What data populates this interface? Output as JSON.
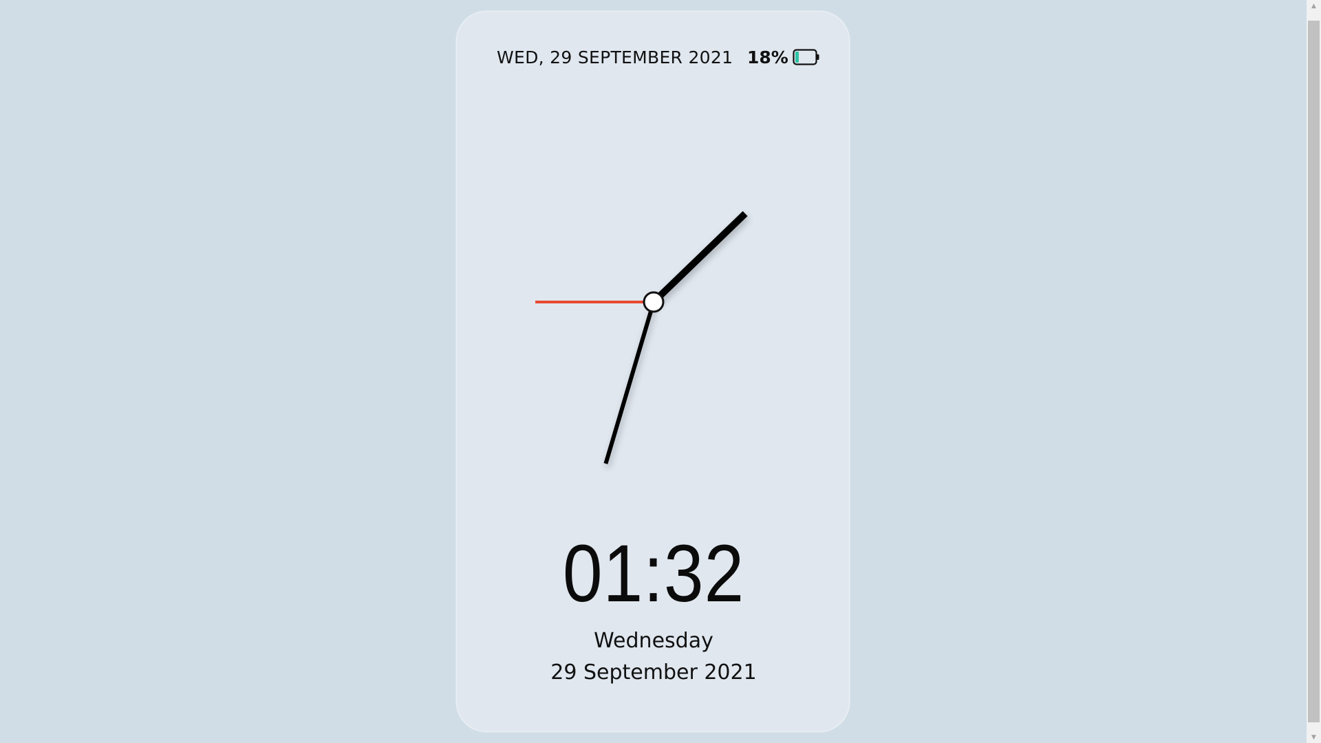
{
  "status_bar": {
    "date": "WED, 29 SEPTEMBER 2021",
    "battery_percent_label": "18%",
    "battery_level": 0.18,
    "battery_accent_color": "#2ec4a6",
    "battery_icon": "battery-icon"
  },
  "clock": {
    "hour": 1,
    "minute": 32,
    "second": 45,
    "hand_color": "#000000",
    "second_hand_color": "#e8492f",
    "center_cap_color": "#ffffff"
  },
  "digital": {
    "time": "01:32",
    "day": "Wednesday",
    "date": "29 September 2021"
  },
  "scrollbar": {
    "up_glyph": "▲",
    "down_glyph": "▼"
  }
}
